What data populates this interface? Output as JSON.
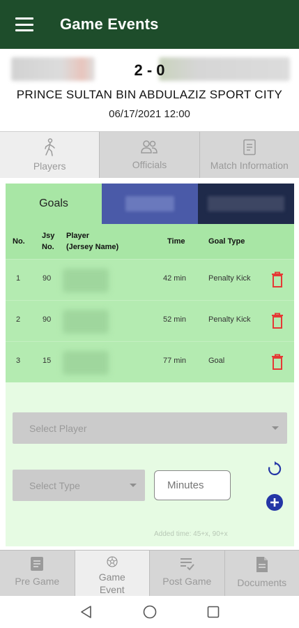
{
  "appbar": {
    "title": "Game Events"
  },
  "match": {
    "score": "2 - 0",
    "venue": "PRINCE SULTAN BIN ABDULAZIZ SPORT CITY",
    "datetime": "06/17/2021 12:00"
  },
  "top_tabs": [
    {
      "label": "Players",
      "icon": "walking-person-icon",
      "active": true
    },
    {
      "label": "Officials",
      "icon": "people-icon",
      "active": false
    },
    {
      "label": "Match Information",
      "icon": "document-icon",
      "active": false
    }
  ],
  "event_tabs": {
    "goals": "Goals"
  },
  "goals_table": {
    "headers": {
      "no": "No.",
      "jsy": "Jsy\nNo.",
      "player": "Player\n(Jersey Name)",
      "time": "Time",
      "type": "Goal Type"
    },
    "rows": [
      {
        "no": "1",
        "jsy": "90",
        "time": "42 min",
        "type": "Penalty Kick"
      },
      {
        "no": "2",
        "jsy": "90",
        "time": "52 min",
        "type": "Penalty Kick"
      },
      {
        "no": "3",
        "jsy": "15",
        "time": "77 min",
        "type": "Goal"
      }
    ]
  },
  "form": {
    "select_player": "Select Player",
    "select_type": "Select Type",
    "minutes_placeholder": "Minutes",
    "hint": "Added time: 45+x, 90+x"
  },
  "bottom_nav": [
    {
      "label": "Pre Game",
      "icon": "pregame-doc-icon",
      "active": false
    },
    {
      "label": "Game Event",
      "icon": "soccer-ball-icon",
      "active": true
    },
    {
      "label": "Post Game",
      "icon": "checklist-icon",
      "active": false
    },
    {
      "label": "Documents",
      "icon": "file-icon",
      "active": false
    }
  ],
  "colors": {
    "appbar": "#1e4d2b",
    "delete": "#e53935",
    "add": "#2436a6"
  }
}
